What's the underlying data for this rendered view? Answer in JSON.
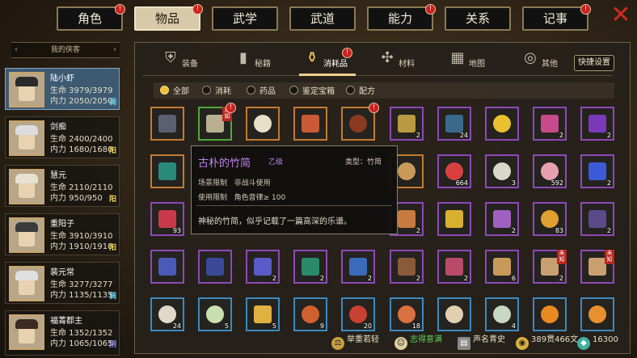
{
  "tabs": [
    {
      "label": "角色",
      "badge": "!"
    },
    {
      "label": "物品",
      "badge": "!",
      "active": true
    },
    {
      "label": "武学",
      "badge": ""
    },
    {
      "label": "武道",
      "badge": ""
    },
    {
      "label": "能力",
      "badge": "!"
    },
    {
      "label": "关系",
      "badge": ""
    },
    {
      "label": "记事",
      "badge": "!"
    }
  ],
  "sidebar": {
    "header": "我的侠客",
    "characters": [
      {
        "name": "陆小虾",
        "hp": "生命 3979/3979",
        "mp": "内力 2050/2050",
        "tag": "调",
        "tag_color": "#6ac8e0"
      },
      {
        "name": "剑痴",
        "hp": "生命 2400/2400",
        "mp": "内力 1680/1680",
        "tag": "阳",
        "tag_color": "#f0d050"
      },
      {
        "name": "慧元",
        "hp": "生命 2110/2110",
        "mp": "内力 950/950",
        "tag": "阳",
        "tag_color": "#f0d050"
      },
      {
        "name": "重阳子",
        "hp": "生命 3910/3910",
        "mp": "内力 1910/1910",
        "tag": "阳",
        "tag_color": "#f0d050"
      },
      {
        "name": "裴元常",
        "hp": "生命 3277/3277",
        "mp": "内力 1135/1135",
        "tag": "调",
        "tag_color": "#6ac8e0"
      },
      {
        "name": "福菁郡主",
        "hp": "生命 1352/1352",
        "mp": "内力 1065/1065",
        "tag": "阴",
        "tag_color": "#a0a0ff"
      }
    ]
  },
  "categories": [
    {
      "label": "装备",
      "icon": "armor-icon"
    },
    {
      "label": "秘籍",
      "icon": "book-icon"
    },
    {
      "label": "消耗品",
      "icon": "potion-icon",
      "active": true,
      "badge": "!"
    },
    {
      "label": "材料",
      "icon": "herb-icon"
    },
    {
      "label": "地图",
      "icon": "map-icon"
    },
    {
      "label": "其他",
      "icon": "misc-icon"
    }
  ],
  "config_button": "快捷设置",
  "filters": [
    {
      "label": "全部",
      "active": true
    },
    {
      "label": "消耗"
    },
    {
      "label": "药品"
    },
    {
      "label": "鉴定宝箱"
    },
    {
      "label": "配方"
    }
  ],
  "tooltip": {
    "name": "古朴的竹简",
    "grade": "乙级",
    "type": "类型：竹简",
    "scene": "场景限制",
    "scene_val": "非战斗使用",
    "use": "使用限制",
    "use_val": "角色音律≥ 100",
    "desc": "神秘的竹简，似乎记载了一篇高深的乐谱。"
  },
  "bottom": {
    "weight": "举重若轻",
    "mood": "志得意满",
    "fame": "声名青史",
    "money": "389贯466文",
    "gems": "16300"
  },
  "colors": {
    "accent": "#f0c030",
    "badge": "#c8231f",
    "active_char": "#3d5a72"
  }
}
